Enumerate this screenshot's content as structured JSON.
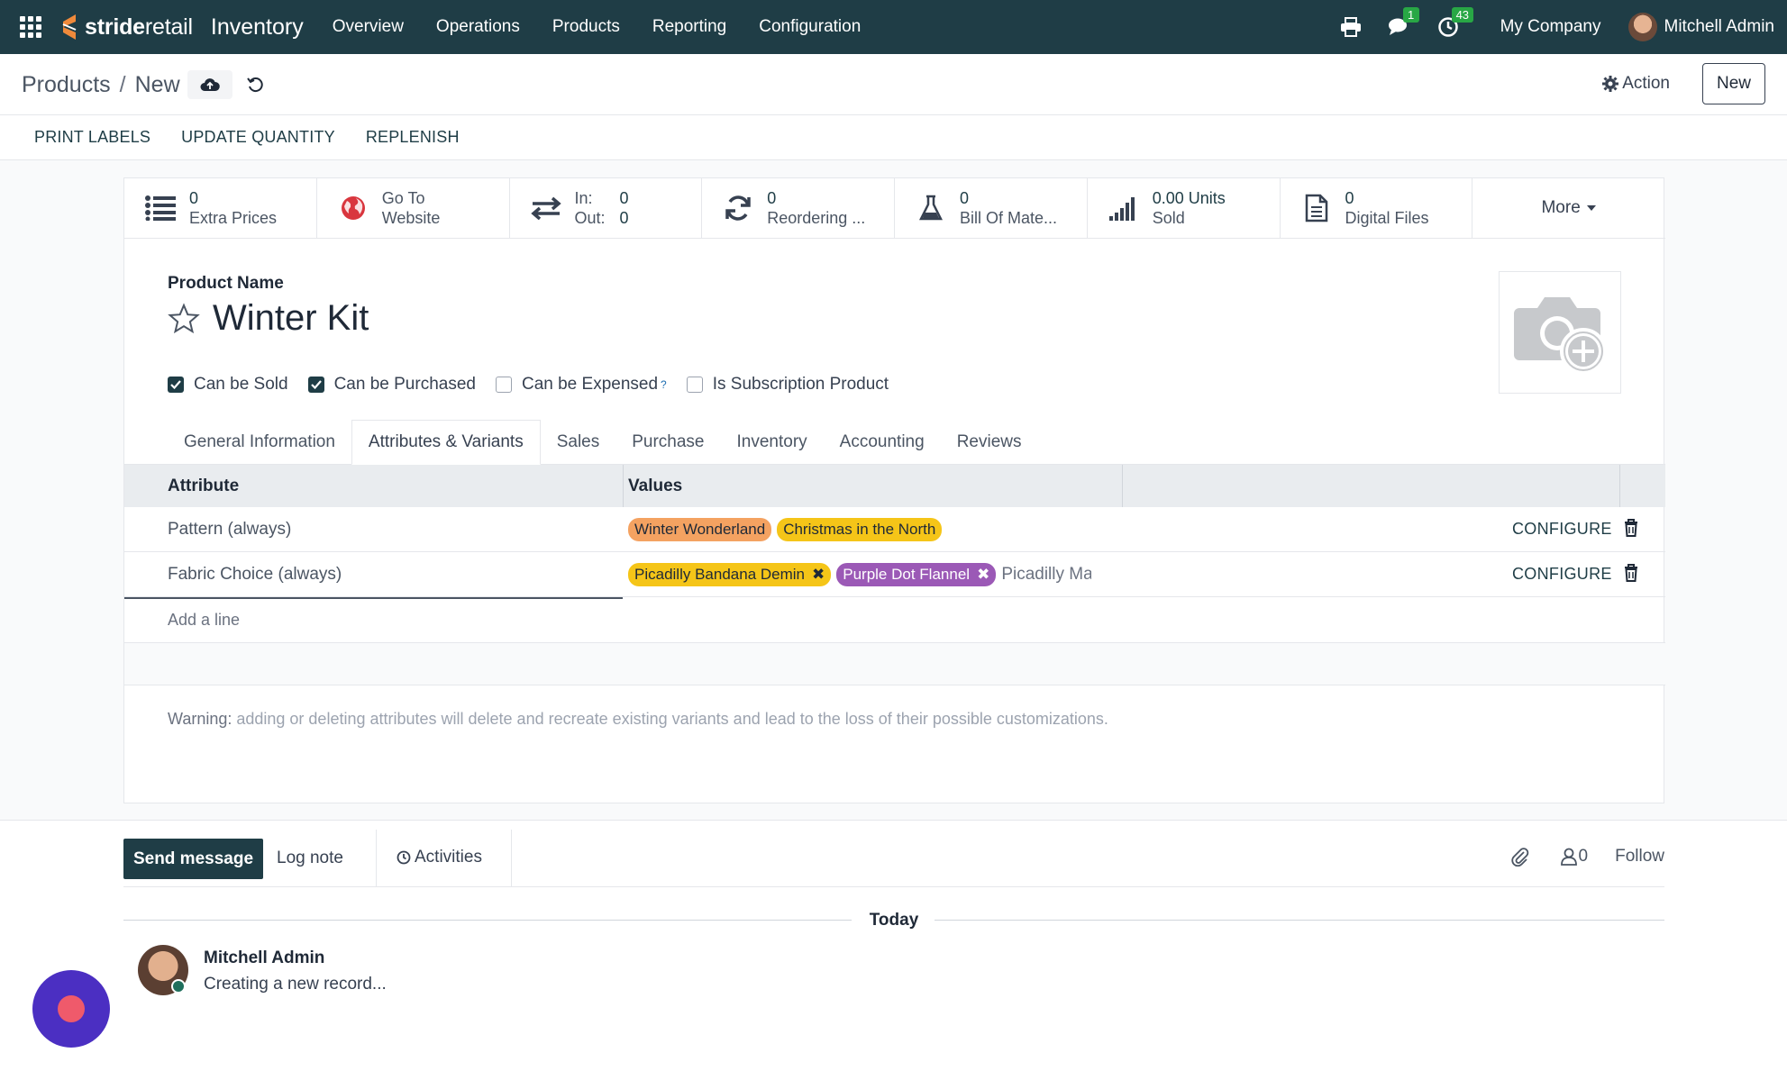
{
  "navbar": {
    "brand_bold": "stride",
    "brand_light": "retail",
    "app_name": "Inventory",
    "menu": [
      "Overview",
      "Operations",
      "Products",
      "Reporting",
      "Configuration"
    ],
    "messages_badge": "1",
    "activities_badge": "43",
    "company": "My Company",
    "user": "Mitchell Admin"
  },
  "control": {
    "breadcrumb_parent": "Products",
    "breadcrumb_sep": "/",
    "breadcrumb_current": "New",
    "action_label": "Action",
    "new_label": "New"
  },
  "statusbar": {
    "buttons": [
      "PRINT LABELS",
      "UPDATE QUANTITY",
      "REPLENISH"
    ]
  },
  "smart_buttons": {
    "extra_prices": {
      "value": "0",
      "label": "Extra Prices"
    },
    "website": {
      "line1": "Go To",
      "line2": "Website"
    },
    "in_out": {
      "in_label": "In:",
      "in_value": "0",
      "out_label": "Out:",
      "out_value": "0"
    },
    "reordering": {
      "value": "0",
      "label": "Reordering ..."
    },
    "bom": {
      "value": "0",
      "label": "Bill Of Mate..."
    },
    "sold": {
      "value": "0.00 Units",
      "label": "Sold"
    },
    "digital_files": {
      "value": "0",
      "label": "Digital Files"
    },
    "more": "More"
  },
  "product": {
    "name_label": "Product Name",
    "name": "Winter Kit",
    "checks": [
      {
        "label": "Can be Sold",
        "checked": true
      },
      {
        "label": "Can be Purchased",
        "checked": true
      },
      {
        "label": "Can be Expensed",
        "checked": false
      },
      {
        "label": "Is Subscription Product",
        "checked": false
      }
    ],
    "expensed_help": "?"
  },
  "tabs": [
    "General Information",
    "Attributes & Variants",
    "Sales",
    "Purchase",
    "Inventory",
    "Accounting",
    "Reviews"
  ],
  "active_tab": "Attributes & Variants",
  "attributes": {
    "header_attribute": "Attribute",
    "header_values": "Values",
    "rows": [
      {
        "name": "Pattern (always)",
        "tags": [
          {
            "label": "Winter Wonderland",
            "color": "#f4a261"
          },
          {
            "label": "Christmas in the North",
            "color": "#f5c518"
          }
        ],
        "configure": "CONFIGURE"
      },
      {
        "name": "Fabric Choice (always)",
        "tags": [
          {
            "label": "Picadilly Bandana Demin",
            "color": "#f5c518",
            "x": "✖"
          },
          {
            "label": "Purple Dot Flannel",
            "color": "#9b59b6",
            "x": "✖"
          }
        ],
        "input_text": "Picadilly Ma",
        "configure": "CONFIGURE"
      }
    ],
    "add_line": "Add a line",
    "warning_label": "Warning:",
    "warning_text": " adding or deleting attributes will delete and recreate existing variants and lead to the loss of their possible customizations."
  },
  "chatter": {
    "send_message": "Send message",
    "log_note": "Log note",
    "activities": "Activities",
    "followers_count": "0",
    "follow": "Follow",
    "today": "Today",
    "message_author": "Mitchell Admin",
    "message_body": "Creating a new record..."
  }
}
